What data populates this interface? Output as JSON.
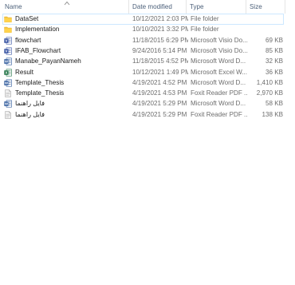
{
  "columns": {
    "name": "Name",
    "date": "Date modified",
    "type": "Type",
    "size": "Size"
  },
  "files": [
    {
      "name": "DataSet",
      "date": "10/12/2021 2:03 PM",
      "type": "File folder",
      "size": "",
      "icon": "folder-icon",
      "selected": true
    },
    {
      "name": "Implementation",
      "date": "10/10/2021 3:32 PM",
      "type": "File folder",
      "size": "",
      "icon": "folder-icon",
      "selected": false
    },
    {
      "name": "flowchart",
      "date": "11/18/2015 6:29 PM",
      "type": "Microsoft Visio Do...",
      "size": "69 KB",
      "icon": "visio-icon",
      "selected": false
    },
    {
      "name": "IFAB_Flowchart",
      "date": "9/24/2016 5:14 PM",
      "type": "Microsoft Visio Do...",
      "size": "85 KB",
      "icon": "visio-icon",
      "selected": false
    },
    {
      "name": "Manabe_PayanNameh",
      "date": "11/18/2015 4:52 PM",
      "type": "Microsoft Word D...",
      "size": "32 KB",
      "icon": "word-icon",
      "selected": false
    },
    {
      "name": "Result",
      "date": "10/12/2021 1:49 PM",
      "type": "Microsoft Excel W...",
      "size": "36 KB",
      "icon": "excel-icon",
      "selected": false
    },
    {
      "name": "Template_Thesis",
      "date": "4/19/2021 4:52 PM",
      "type": "Microsoft Word D...",
      "size": "1,410 KB",
      "icon": "word-icon",
      "selected": false
    },
    {
      "name": "Template_Thesis",
      "date": "4/19/2021 4:53 PM",
      "type": "Foxit Reader PDF ...",
      "size": "2,970 KB",
      "icon": "pdf-icon",
      "selected": false
    },
    {
      "name": "فایل راهنما",
      "date": "4/19/2021 5:29 PM",
      "type": "Microsoft Word D...",
      "size": "58 KB",
      "icon": "word-icon",
      "selected": false
    },
    {
      "name": "فایل راهنما",
      "date": "4/19/2021 5:29 PM",
      "type": "Foxit Reader PDF ...",
      "size": "138 KB",
      "icon": "pdf-icon",
      "selected": false
    }
  ],
  "colors": {
    "folder": "#f4c542",
    "visio": "#3955a3",
    "word": "#2b579a",
    "excel": "#217346",
    "pdf": "#f0f0f0"
  }
}
